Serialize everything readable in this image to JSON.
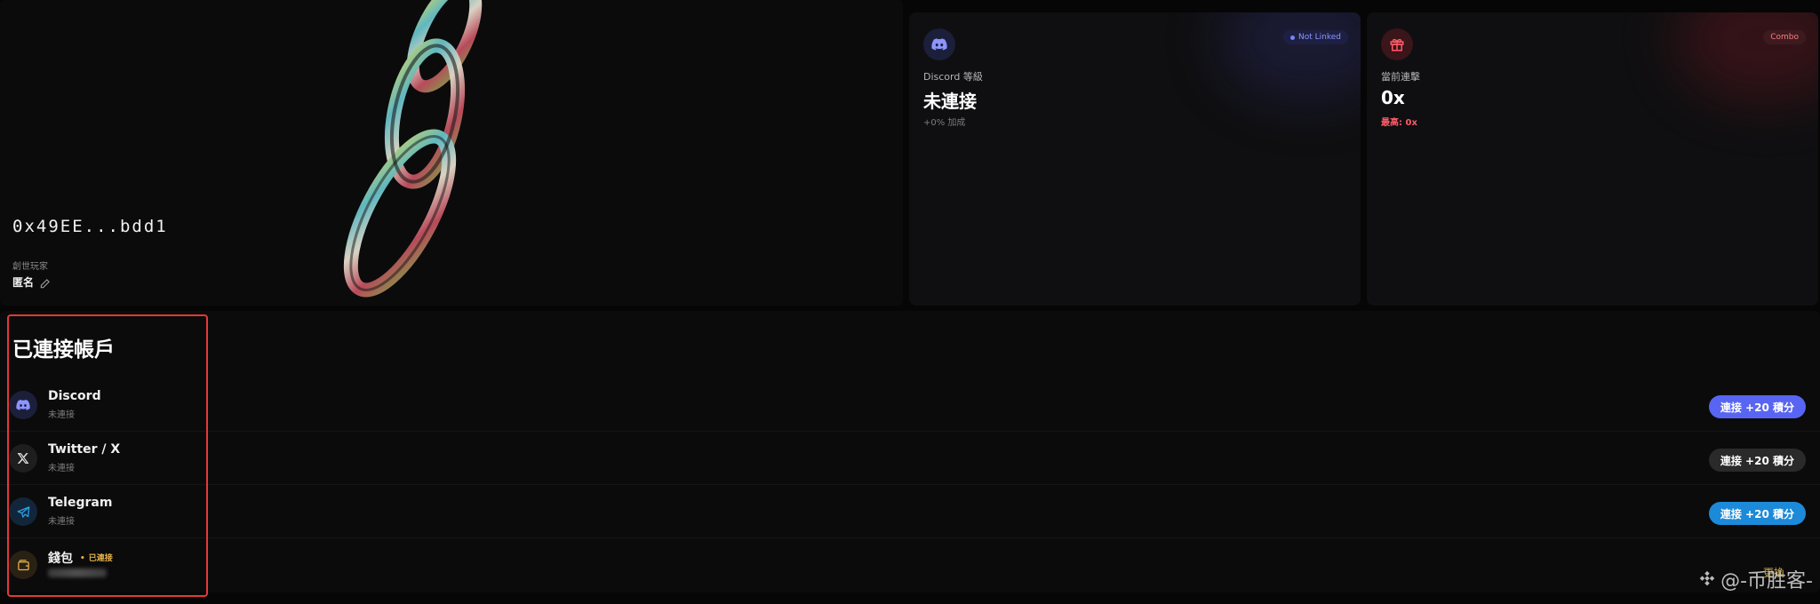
{
  "profile": {
    "wallet_address": "0x49EE...bdd1",
    "role": "創世玩家",
    "name": "匿名"
  },
  "discord_stat": {
    "badge": "Not Linked",
    "label": "Discord 等級",
    "value": "未連接",
    "sub": "+0% 加成",
    "icon": "discord-icon"
  },
  "combo_stat": {
    "badge": "Combo",
    "label": "當前連擊",
    "value": "0x",
    "sub": "最高: 0x",
    "icon": "gift-icon"
  },
  "accounts": {
    "title": "已連接帳戶",
    "items": [
      {
        "name": "Discord",
        "status": "未連接",
        "button": "連接 +20 積分",
        "icon": "discord-icon",
        "accent": "#5865f2"
      },
      {
        "name": "Twitter / X",
        "status": "未連接",
        "button": "連接 +20 積分",
        "icon": "x-icon",
        "accent": "#2a2a2a"
      },
      {
        "name": "Telegram",
        "status": "未連接",
        "button": "連接 +20 積分",
        "icon": "telegram-icon",
        "accent": "#1c8ad9"
      },
      {
        "name": "錢包",
        "status_tag": "已連接",
        "action": "更換",
        "icon": "wallet-icon",
        "accent": "#e6b24a"
      }
    ]
  },
  "watermark": "@-币胜客-"
}
